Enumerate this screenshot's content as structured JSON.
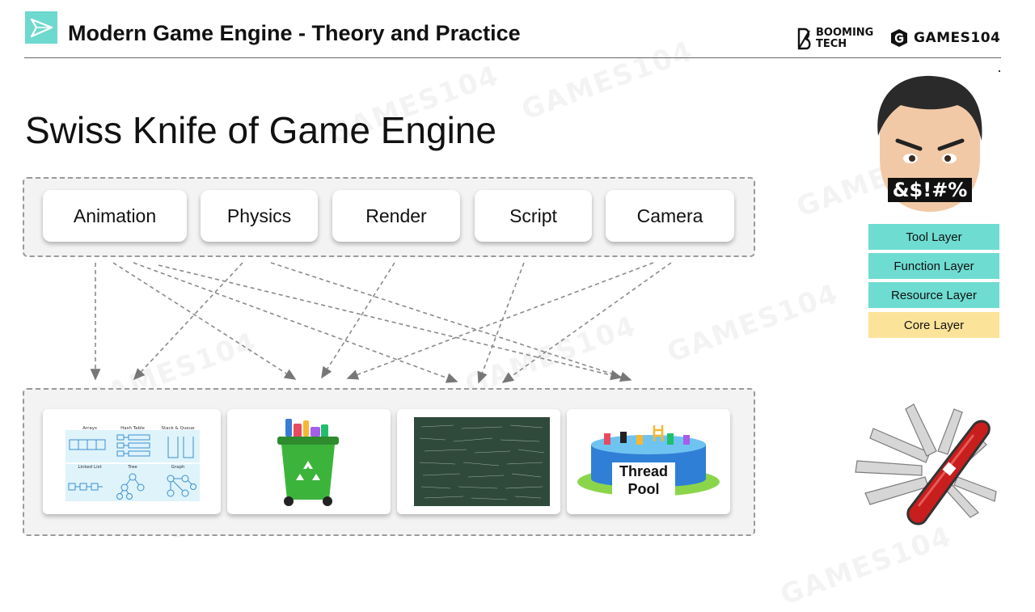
{
  "header": {
    "title": "Modern Game Engine - Theory and Practice",
    "brand_booming_line1": "BOOMING",
    "brand_booming_line2": "TECH",
    "brand_games": "GAMES104"
  },
  "slide": {
    "title": "Swiss Knife of Game Engine"
  },
  "function_modules": [
    "Animation",
    "Physics",
    "Render",
    "Script",
    "Camera"
  ],
  "core_cards": {
    "data_structures": {
      "arrays": "Arrays",
      "hash_table": "Hash Table",
      "stack_queue": "Stack & Queue",
      "linked_list": "Linked List",
      "tree": "Tree",
      "graph": "Graph"
    },
    "thread_pool_line1": "Thread",
    "thread_pool_line2": "Pool"
  },
  "avatar": {
    "mask_text": "&$!#%"
  },
  "layers": [
    {
      "label": "Tool Layer",
      "color": "#6fdcd1"
    },
    {
      "label": "Function Layer",
      "color": "#6fdcd1"
    },
    {
      "label": "Resource Layer",
      "color": "#6fdcd1"
    },
    {
      "label": "Core Layer",
      "color": "#fbe39a"
    }
  ],
  "colors": {
    "accent_teal": "#6ed9cf",
    "core_yellow": "#fbe39a"
  }
}
